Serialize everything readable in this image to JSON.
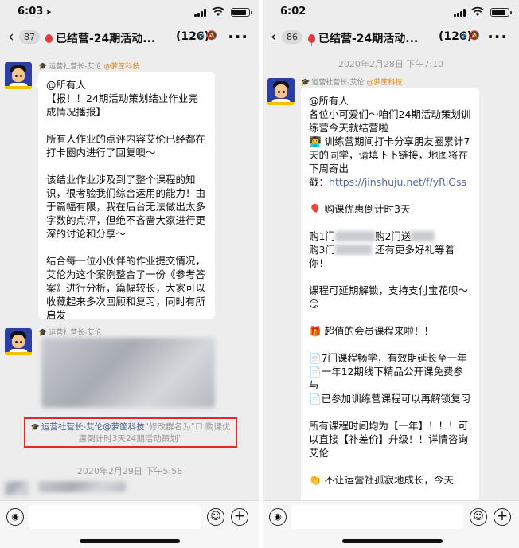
{
  "left": {
    "status": {
      "time": "6:03",
      "battery_level": 0.85
    },
    "nav": {
      "unread": "87",
      "title": "已结营-24期活动...",
      "count": "(126)"
    },
    "sender_name": "运营社营长-艾伦",
    "sender_company": "@萝筐科技",
    "message1": "@所有人\n【报！！24期活动策划结业作业完成情况播报】\n\n所有人作业的点评内容艾伦已经都在打卡圈内进行了回复噢～\n\n该结业作业涉及到了整个课程的知识，很考验我们综合运用的能力！由于篇幅有限，我在后台无法做出太多字数的点评，但绝不吝啬大家进行更深的讨论和分享～\n\n结合每一位小伙伴的作业提交情况，艾伦为这个案例整合了一份《参考答案》进行分析，篇幅较长，大家可以收藏起来多次回顾和复习，同时有所启发",
    "system_user": "运营社营长-艾伦@萝筐科技",
    "system_text": "“修改群名为“☐ 购课优惠倒计时3天24期活动策划”",
    "timestamp": "2020年2月29日 下午5:56"
  },
  "right": {
    "status": {
      "time": "6:02",
      "battery_level": 0.85
    },
    "nav": {
      "unread": "86",
      "title": "已结营-24期活动...",
      "count": "(126)"
    },
    "timestamp": "2020年2月28日 下午7:10",
    "sender_name": "运营社营长-艾伦",
    "sender_company": "@萝筐科技",
    "msg_part1": "@所有人\n各位小可爱们～咱们24期活动策划训练营今天就结营啦\n👨‍💻 训练营期间打卡分享朋友圈累计7天的同学，请填下下链接，地图将在下周寄出\n戳：",
    "link": "https://jinshuju.net/f/yRiGss",
    "msg_part2": "🎈 购课优惠倒计时3天",
    "line_buy1a": "购1门",
    "line_buy1b": "购2门送",
    "line_buy3a": "购3门",
    "line_buy3b": "还有更多好礼等着你！",
    "msg_part3": "课程可延期解锁，支持支付宝花呗～😏\n\n🎁 超值的会员课程来啦！！\n\n📄7门课程畅学，有效期延长至一年\n📄一年12期线下精品公开课免费参与\n📄已参加训练营课程可以再解锁复习\n\n所有课程时间均为【一年】！！！可以直接【补差价】升级！！详情咨询艾伦\n\n👏 不让运营社孤寂地成长，今天"
  },
  "icons": [
    "back-chevron",
    "balloon",
    "group-add",
    "mute",
    "more-dots",
    "voice",
    "emoji",
    "plus"
  ]
}
